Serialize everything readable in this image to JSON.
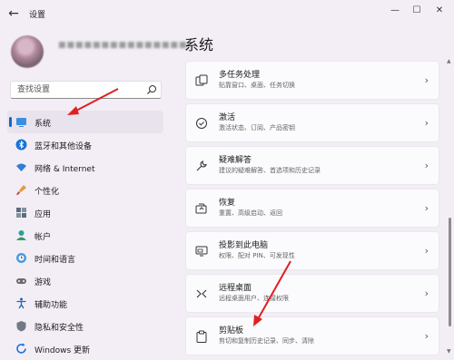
{
  "window": {
    "title": "设置",
    "back_glyph": "←",
    "minimize_glyph": "—",
    "maximize_glyph": "☐",
    "close_glyph": "✕"
  },
  "user": {
    "name": "■■■■■■■■■■■■■■■"
  },
  "search": {
    "placeholder": "查找设置"
  },
  "nav": [
    {
      "label": "系统",
      "icon": "monitor-icon",
      "active": true
    },
    {
      "label": "蓝牙和其他设备",
      "icon": "bluetooth-icon"
    },
    {
      "label": "网络 & Internet",
      "icon": "wifi-icon"
    },
    {
      "label": "个性化",
      "icon": "brush-icon"
    },
    {
      "label": "应用",
      "icon": "apps-icon"
    },
    {
      "label": "帐户",
      "icon": "person-icon"
    },
    {
      "label": "时间和语言",
      "icon": "globe-clock-icon"
    },
    {
      "label": "游戏",
      "icon": "gamepad-icon"
    },
    {
      "label": "辅助功能",
      "icon": "accessibility-icon"
    },
    {
      "label": "隐私和安全性",
      "icon": "shield-icon"
    },
    {
      "label": "Windows 更新",
      "icon": "windows-update-icon"
    }
  ],
  "main": {
    "page_title": "系统",
    "cards": [
      {
        "title": "多任务处理",
        "subtitle": "贴靠窗口、桌面、任务切换",
        "icon": "multitasking-icon"
      },
      {
        "title": "激活",
        "subtitle": "激活状态、订阅、产品密钥",
        "icon": "activation-check-icon"
      },
      {
        "title": "疑难解答",
        "subtitle": "建议的疑难解答、首选项和历史记录",
        "icon": "wrench-icon"
      },
      {
        "title": "恢复",
        "subtitle": "重置、高级启动、返回",
        "icon": "recovery-icon"
      },
      {
        "title": "投影到此电脑",
        "subtitle": "权限、配对 PIN、可发现性",
        "icon": "project-icon"
      },
      {
        "title": "远程桌面",
        "subtitle": "远程桌面用户、连接权限",
        "icon": "remote-desktop-icon"
      },
      {
        "title": "剪贴板",
        "subtitle": "剪切和复制历史记录、同步、清除",
        "icon": "clipboard-icon"
      }
    ],
    "chevron": "›"
  },
  "colors": {
    "accent": "#1468c8",
    "annotation_arrow": "#e02020",
    "background": "#f3eef6"
  }
}
